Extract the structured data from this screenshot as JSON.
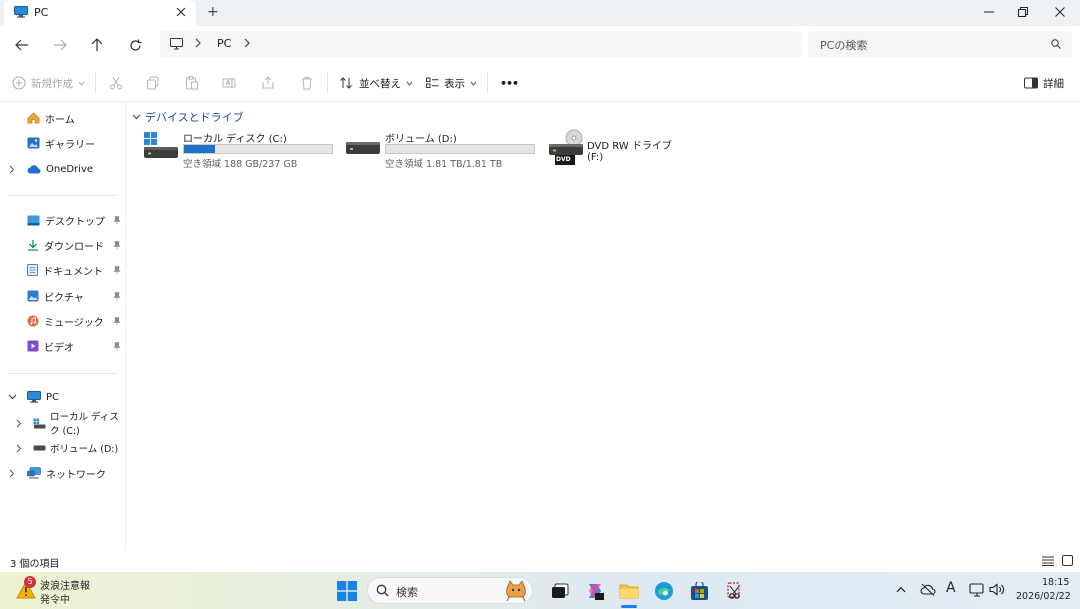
{
  "window": {
    "tab_title": "PC",
    "new_tab": "+"
  },
  "address": {
    "crumb_pc": "PC",
    "search_placeholder": "PCの検索"
  },
  "toolbar": {
    "new_label": "新規作成",
    "sort_label": "並べ替え",
    "view_label": "表示",
    "more_label": "•••",
    "details_label": "詳細"
  },
  "sidebar": {
    "quick": [
      {
        "label": "ホーム"
      },
      {
        "label": "ギャラリー"
      },
      {
        "label": "OneDrive"
      }
    ],
    "pinned": [
      {
        "label": "デスクトップ"
      },
      {
        "label": "ダウンロード"
      },
      {
        "label": "ドキュメント"
      },
      {
        "label": "ピクチャ"
      },
      {
        "label": "ミュージック"
      },
      {
        "label": "ビデオ"
      }
    ],
    "tree": [
      {
        "label": "PC"
      },
      {
        "label": "ローカル ディスク (C:)"
      },
      {
        "label": "ボリューム (D:)"
      },
      {
        "label": "ネットワーク"
      }
    ]
  },
  "content": {
    "group_title": "デバイスとドライブ",
    "drives": [
      {
        "name": "ローカル ディスク (C:)",
        "free_text": "空き領域 188 GB/237 GB",
        "used_fraction": 0.207
      },
      {
        "name": "ボリューム (D:)",
        "free_text": "空き領域 1.81 TB/1.81 TB",
        "used_fraction": 0.0
      },
      {
        "name": "DVD RW ドライブ (F:)",
        "badge": "DVD"
      }
    ]
  },
  "status": {
    "item_count": "3 個の項目"
  },
  "taskbar": {
    "weather_badge": "5",
    "weather_title": "波浪注意報",
    "weather_sub": "発令中",
    "search_label": "検索",
    "time": "18:15",
    "date": "2026/02/22",
    "ime": "A"
  },
  "colors": {
    "accent": "#1e73c8"
  }
}
